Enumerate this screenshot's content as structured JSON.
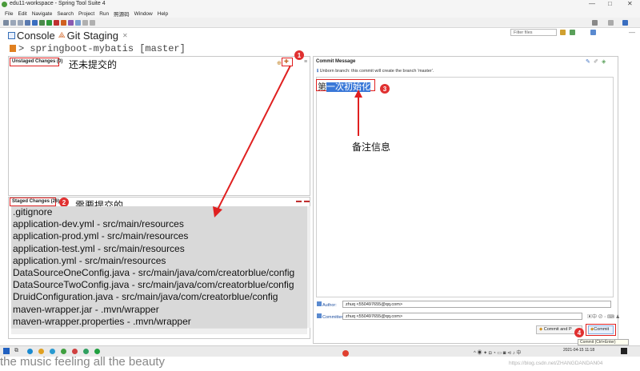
{
  "window": {
    "title": "edu11-workspace - Spring Tool Suite 4",
    "controls": [
      "—",
      "□",
      "✕"
    ]
  },
  "menu": [
    "File",
    "Edit",
    "Navigate",
    "Search",
    "Project",
    "Run",
    "照源码",
    "Window",
    "Help"
  ],
  "toolbar": {
    "filter_placeholder": "Filter files"
  },
  "views": {
    "tabs": [
      {
        "label": "Console",
        "icon": "console-icon"
      },
      {
        "label": "Git Staging",
        "icon": "git-staging-icon",
        "active": true
      }
    ]
  },
  "repo": {
    "path": "> springboot-mybatis [master]"
  },
  "unstaged": {
    "header": "Unstaged Changes (0)",
    "annotation": "还未提交的"
  },
  "staged": {
    "header": "Staged Changes (26)",
    "annotation": "需要提交的",
    "files": [
      ".gitignore",
      "application-dev.yml - src/main/resources",
      "application-prod.yml - src/main/resources",
      "application-test.yml - src/main/resources",
      "application.yml - src/main/resources",
      "DataSourceOneConfig.java - src/main/java/com/creatorblue/config",
      "DataSourceTwoConfig.java - src/main/java/com/creatorblue/config",
      "DruidConfiguration.java - src/main/java/com/creatorblue/config",
      "maven-wrapper.jar - .mvn/wrapper",
      "maven-wrapper.properties - .mvn/wrapper"
    ]
  },
  "commit": {
    "header": "Commit Message",
    "info": "Unborn branch: this commit will create the branch 'master'.",
    "message_prefix": "第",
    "message_selected": "一次初始化",
    "note": "备注信息",
    "author_label": "Author:",
    "author_value": "zhuq <550497655@qq.com>",
    "committer_label": "Committer:",
    "committer_value": "zhuq <550497655@qq.com>",
    "commit_and_push_label": "Commit and P",
    "commit_label": "Commit",
    "commit_tooltip": "Commit (Ctrl+Enter)"
  },
  "markers": [
    "1",
    "2",
    "3",
    "4"
  ],
  "taskbar": {
    "datetime": "2021-04-15 11:18"
  },
  "subtitle": "the music feeling all the beauty",
  "watermark": "https://blog.csdn.net/ZHANGDANDAN04",
  "colors": {
    "annotation_red": "#e02020",
    "staged_bg": "#d9d9d9",
    "selection_blue": "#3a78d8"
  }
}
